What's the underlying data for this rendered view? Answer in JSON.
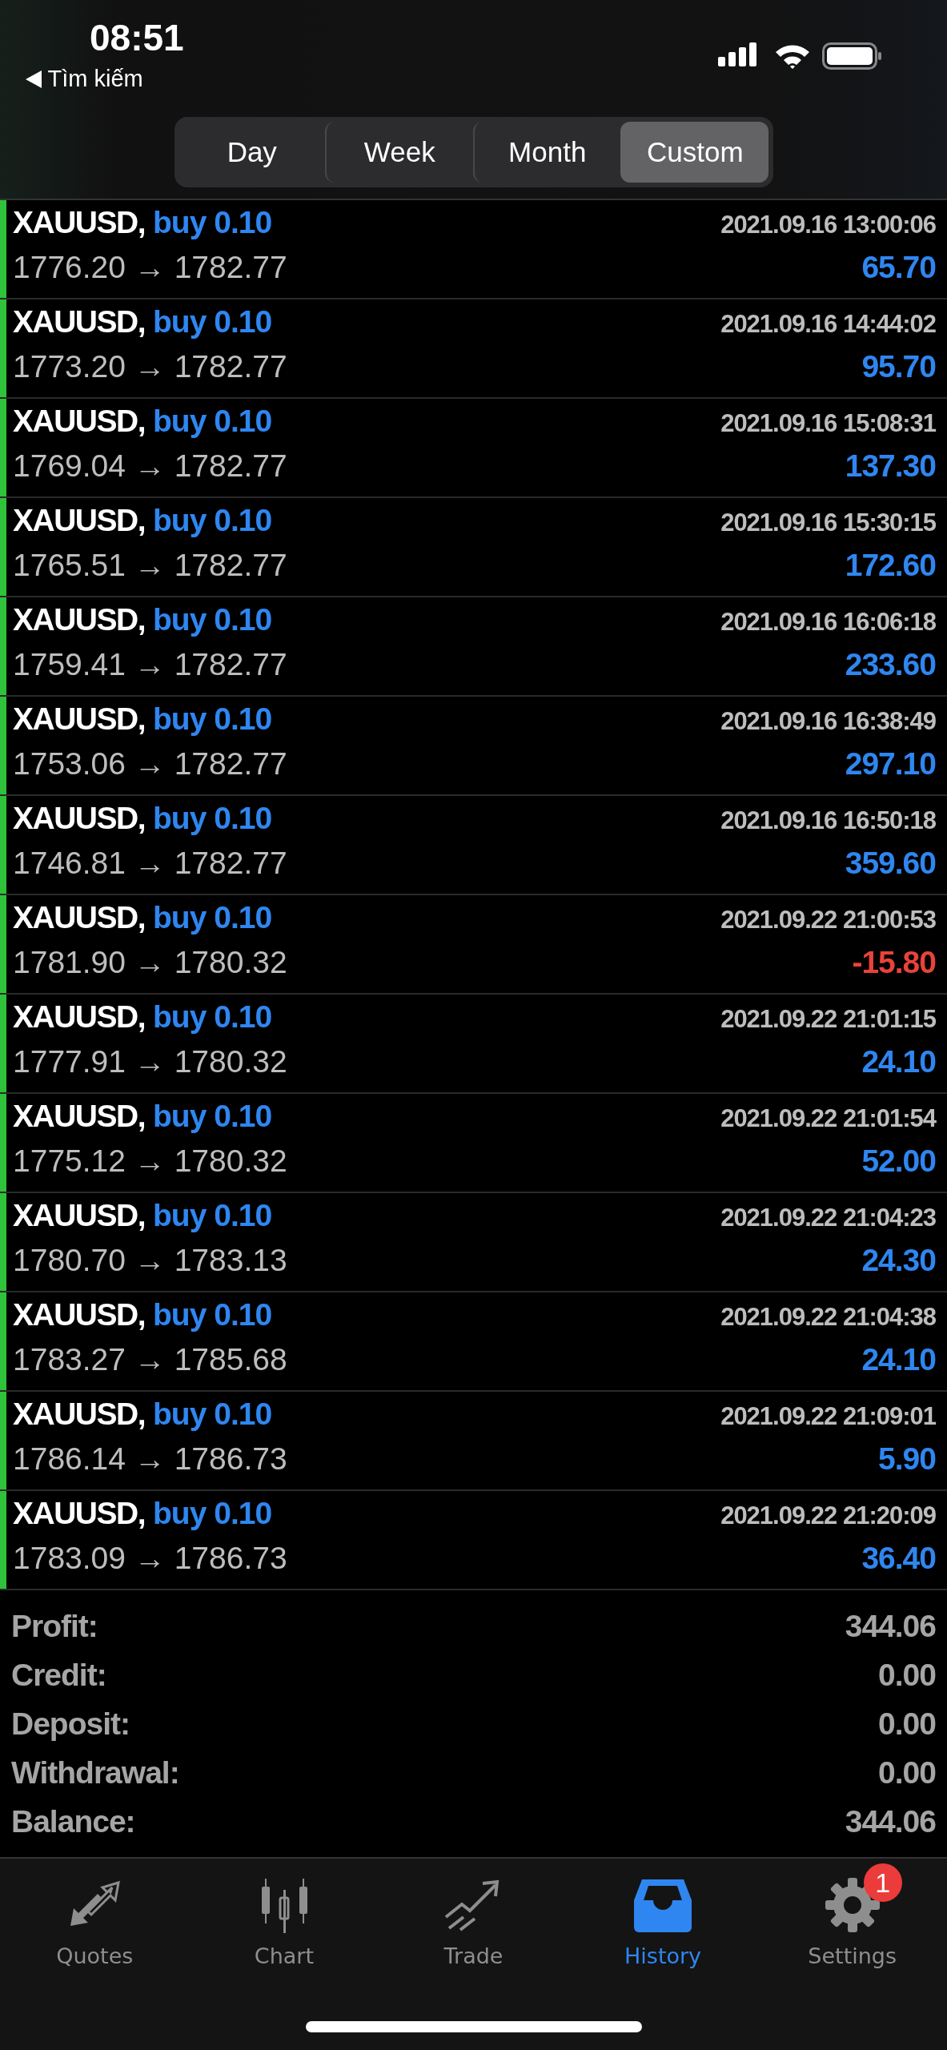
{
  "status_bar": {
    "time": "08:51",
    "back_label": "Tìm kiếm"
  },
  "period_tabs": [
    {
      "label": "Day",
      "selected": false
    },
    {
      "label": "Week",
      "selected": false
    },
    {
      "label": "Month",
      "selected": false
    },
    {
      "label": "Custom",
      "selected": true
    }
  ],
  "trades": [
    {
      "symbol": "XAUUSD,",
      "side": "buy 0.10",
      "time": "2021.09.16 13:00:06",
      "prices": "1776.20 → 1782.77",
      "profit": "65.70",
      "loss": false
    },
    {
      "symbol": "XAUUSD,",
      "side": "buy 0.10",
      "time": "2021.09.16 14:44:02",
      "prices": "1773.20 → 1782.77",
      "profit": "95.70",
      "loss": false
    },
    {
      "symbol": "XAUUSD,",
      "side": "buy 0.10",
      "time": "2021.09.16 15:08:31",
      "prices": "1769.04 → 1782.77",
      "profit": "137.30",
      "loss": false
    },
    {
      "symbol": "XAUUSD,",
      "side": "buy 0.10",
      "time": "2021.09.16 15:30:15",
      "prices": "1765.51 → 1782.77",
      "profit": "172.60",
      "loss": false
    },
    {
      "symbol": "XAUUSD,",
      "side": "buy 0.10",
      "time": "2021.09.16 16:06:18",
      "prices": "1759.41 → 1782.77",
      "profit": "233.60",
      "loss": false
    },
    {
      "symbol": "XAUUSD,",
      "side": "buy 0.10",
      "time": "2021.09.16 16:38:49",
      "prices": "1753.06 → 1782.77",
      "profit": "297.10",
      "loss": false
    },
    {
      "symbol": "XAUUSD,",
      "side": "buy 0.10",
      "time": "2021.09.16 16:50:18",
      "prices": "1746.81 → 1782.77",
      "profit": "359.60",
      "loss": false
    },
    {
      "symbol": "XAUUSD,",
      "side": "buy 0.10",
      "time": "2021.09.22 21:00:53",
      "prices": "1781.90 → 1780.32",
      "profit": "-15.80",
      "loss": true
    },
    {
      "symbol": "XAUUSD,",
      "side": "buy 0.10",
      "time": "2021.09.22 21:01:15",
      "prices": "1777.91 → 1780.32",
      "profit": "24.10",
      "loss": false
    },
    {
      "symbol": "XAUUSD,",
      "side": "buy 0.10",
      "time": "2021.09.22 21:01:54",
      "prices": "1775.12 → 1780.32",
      "profit": "52.00",
      "loss": false
    },
    {
      "symbol": "XAUUSD,",
      "side": "buy 0.10",
      "time": "2021.09.22 21:04:23",
      "prices": "1780.70 → 1783.13",
      "profit": "24.30",
      "loss": false
    },
    {
      "symbol": "XAUUSD,",
      "side": "buy 0.10",
      "time": "2021.09.22 21:04:38",
      "prices": "1783.27 → 1785.68",
      "profit": "24.10",
      "loss": false
    },
    {
      "symbol": "XAUUSD,",
      "side": "buy 0.10",
      "time": "2021.09.22 21:09:01",
      "prices": "1786.14 → 1786.73",
      "profit": "5.90",
      "loss": false
    },
    {
      "symbol": "XAUUSD,",
      "side": "buy 0.10",
      "time": "2021.09.22 21:20:09",
      "prices": "1783.09 → 1786.73",
      "profit": "36.40",
      "loss": false
    }
  ],
  "summary": [
    {
      "label": "Profit:",
      "value": "344.06"
    },
    {
      "label": "Credit:",
      "value": "0.00"
    },
    {
      "label": "Deposit:",
      "value": "0.00"
    },
    {
      "label": "Withdrawal:",
      "value": "0.00"
    },
    {
      "label": "Balance:",
      "value": "344.06"
    }
  ],
  "tab_bar": [
    {
      "kind": "quotes",
      "label": "Quotes",
      "selected": false
    },
    {
      "kind": "chart",
      "label": "Chart",
      "selected": false
    },
    {
      "kind": "trade",
      "label": "Trade",
      "selected": false
    },
    {
      "kind": "history",
      "label": "History",
      "selected": true
    },
    {
      "kind": "settings",
      "label": "Settings",
      "selected": false,
      "badge": "1"
    }
  ]
}
